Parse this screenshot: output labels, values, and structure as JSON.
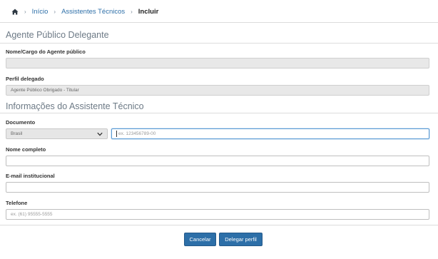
{
  "breadcrumb": {
    "home_icon": "home-icon",
    "items": [
      "Início",
      "Assistentes Técnicos"
    ],
    "current": "Incluir"
  },
  "section_delegante": {
    "title": "Agente Público Delegante",
    "nome_label": "Nome/Cargo do Agente público",
    "nome_value": "",
    "perfil_label": "Perfil delegado",
    "perfil_value": "Agente Público Obrigado - Titular"
  },
  "section_assistente": {
    "title": "Informações do Assistente Técnico",
    "documento_label": "Documento",
    "documento_country": "Brasil",
    "documento_placeholder": "ex. 123456789-00",
    "nome_label": "Nome completo",
    "nome_value": "",
    "email_label": "E-mail institucional",
    "email_value": "",
    "telefone_label": "Telefone",
    "telefone_placeholder": "ex. (61) 95555-5555"
  },
  "actions": {
    "cancel_label": "Cancelar",
    "submit_label": "Delegar perfil"
  },
  "colors": {
    "primary": "#2d6fa8",
    "link": "#2d6fa8",
    "section_title": "#6d7a86",
    "disabled_bg": "#e8e8e8",
    "focus_border": "#5b9bd5"
  }
}
